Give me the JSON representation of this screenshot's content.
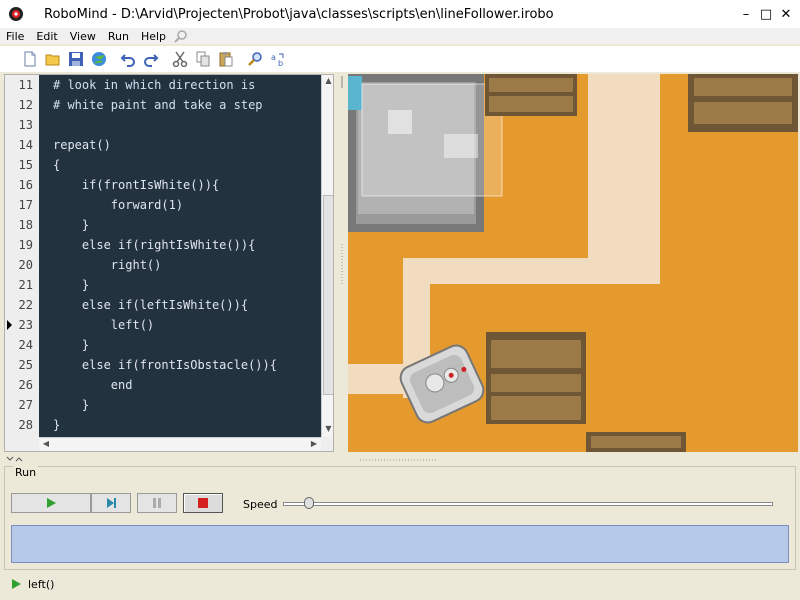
{
  "window": {
    "title": "RoboMind - D:\\Arvid\\Projecten\\Probot\\java\\classes\\scripts\\en\\lineFollower.irobo",
    "app_icon": "robomind-icon",
    "controls": [
      "minimize-icon",
      "maximize-icon",
      "close-icon"
    ]
  },
  "menu": [
    "File",
    "Edit",
    "View",
    "Run",
    "Help"
  ],
  "toolbar": {
    "buttons": [
      "new-file-icon",
      "open-folder-icon",
      "save-icon",
      "open-map-icon",
      "undo-icon",
      "redo-icon",
      "cut-icon",
      "copy-icon",
      "paste-icon",
      "find-icon",
      "replace-icon"
    ]
  },
  "editor": {
    "current_line": 23,
    "lines": [
      {
        "num": "11",
        "text": "# look in which direction is"
      },
      {
        "num": "12",
        "text": "# white paint and take a step"
      },
      {
        "num": "13",
        "text": ""
      },
      {
        "num": "14",
        "text": "repeat()"
      },
      {
        "num": "15",
        "text": "{"
      },
      {
        "num": "16",
        "text": "    if(frontIsWhite()){"
      },
      {
        "num": "17",
        "text": "        forward(1)"
      },
      {
        "num": "18",
        "text": "    }"
      },
      {
        "num": "19",
        "text": "    else if(rightIsWhite()){"
      },
      {
        "num": "20",
        "text": "        right()"
      },
      {
        "num": "21",
        "text": "    }"
      },
      {
        "num": "22",
        "text": "    else if(leftIsWhite()){"
      },
      {
        "num": "23",
        "text": "        left()"
      },
      {
        "num": "24",
        "text": "    }"
      },
      {
        "num": "25",
        "text": "    else if(frontIsObstacle()){"
      },
      {
        "num": "26",
        "text": "        end"
      },
      {
        "num": "27",
        "text": "    }"
      },
      {
        "num": "28",
        "text": "}"
      }
    ]
  },
  "run_panel": {
    "title": "Run",
    "speed_label": "Speed",
    "speed_level": 0.05,
    "buttons": [
      "play-icon",
      "step-icon",
      "pause-icon",
      "stop-icon"
    ]
  },
  "status": {
    "text": "left()",
    "icon": "play-icon"
  },
  "colors": {
    "editor_bg": "#23323f",
    "sand": "#e59a2e",
    "path": "#f2dcc0",
    "output_bg": "#b7c9eb"
  }
}
